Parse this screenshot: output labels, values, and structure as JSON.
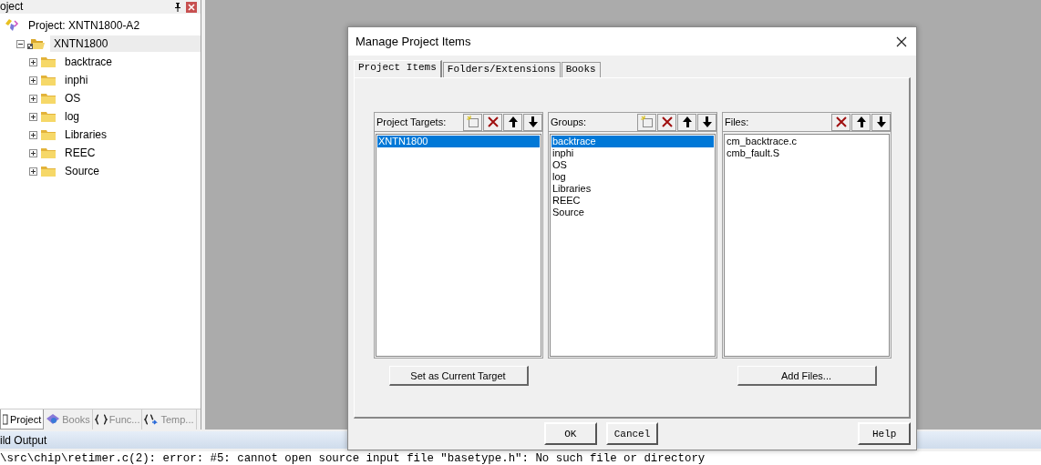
{
  "panel": {
    "title": "oject",
    "tree": {
      "label": "Project: XNTN1800-A2",
      "children": [
        {
          "label": "XNTN1800",
          "selected": true,
          "expanded": true,
          "children": [
            {
              "label": "backtrace",
              "expanded": false
            },
            {
              "label": "inphi",
              "expanded": false
            },
            {
              "label": "OS",
              "expanded": false
            },
            {
              "label": "log",
              "expanded": false
            },
            {
              "label": "Libraries",
              "expanded": false
            },
            {
              "label": "REEC",
              "expanded": false
            },
            {
              "label": "Source",
              "expanded": false
            }
          ]
        }
      ]
    },
    "tabs": [
      {
        "label": "Project",
        "kind": "project",
        "selected": true
      },
      {
        "label": "Books",
        "kind": "books",
        "selected": false
      },
      {
        "label": "Func...",
        "kind": "func",
        "selected": false
      },
      {
        "label": "Temp...",
        "kind": "temp",
        "selected": false
      }
    ]
  },
  "output": {
    "title": "ild Output",
    "lines": [
      "\\src\\chip\\retimer.c(2): error:  #5: cannot open source input file \"basetype.h\": No such file or directory"
    ]
  },
  "dialog": {
    "title": "Manage Project Items",
    "tabs": [
      {
        "label": "Project Items",
        "selected": true
      },
      {
        "label": "Folders/Extensions",
        "selected": false
      },
      {
        "label": "Books",
        "selected": false
      }
    ],
    "lists": [
      {
        "title": "Project Targets:",
        "tools": [
          {
            "kind": "new"
          },
          {
            "kind": "delete"
          },
          {
            "kind": "up"
          },
          {
            "kind": "down"
          }
        ],
        "items": [
          {
            "label": "XNTN1800",
            "selected": true
          }
        ],
        "button": "Set as Current Target"
      },
      {
        "title": "Groups:",
        "tools": [
          {
            "kind": "new"
          },
          {
            "kind": "delete"
          },
          {
            "kind": "up"
          },
          {
            "kind": "down"
          }
        ],
        "items": [
          {
            "label": "backtrace",
            "selected": true
          },
          {
            "label": "inphi",
            "selected": false
          },
          {
            "label": "OS",
            "selected": false
          },
          {
            "label": "log",
            "selected": false
          },
          {
            "label": "Libraries",
            "selected": false
          },
          {
            "label": "REEC",
            "selected": false
          },
          {
            "label": "Source",
            "selected": false
          }
        ]
      },
      {
        "title": "Files:",
        "tools": [
          {
            "kind": "delete"
          },
          {
            "kind": "up"
          },
          {
            "kind": "down"
          }
        ],
        "items": [
          {
            "label": "cm_backtrace.c",
            "selected": false
          },
          {
            "label": "cmb_fault.S",
            "selected": false
          }
        ],
        "button": "Add Files..."
      }
    ],
    "buttons": [
      "OK",
      "Cancel",
      "Help"
    ]
  }
}
